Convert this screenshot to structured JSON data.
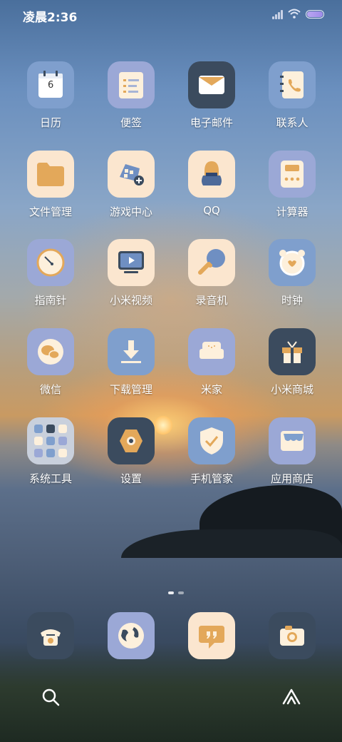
{
  "status": {
    "time": "凌晨2:36"
  },
  "apps": [
    {
      "label": "日历",
      "icon": "calendar-icon",
      "day": "6"
    },
    {
      "label": "便签",
      "icon": "notes-icon"
    },
    {
      "label": "电子邮件",
      "icon": "mail-icon"
    },
    {
      "label": "联系人",
      "icon": "contacts-icon"
    },
    {
      "label": "文件管理",
      "icon": "folder-icon"
    },
    {
      "label": "游戏中心",
      "icon": "gamepad-icon"
    },
    {
      "label": "QQ",
      "icon": "qq-icon"
    },
    {
      "label": "计算器",
      "icon": "calculator-icon"
    },
    {
      "label": "指南针",
      "icon": "compass-icon"
    },
    {
      "label": "小米视频",
      "icon": "video-icon"
    },
    {
      "label": "录音机",
      "icon": "recorder-icon"
    },
    {
      "label": "时钟",
      "icon": "clock-icon"
    },
    {
      "label": "微信",
      "icon": "wechat-icon"
    },
    {
      "label": "下载管理",
      "icon": "download-icon"
    },
    {
      "label": "米家",
      "icon": "mijia-icon"
    },
    {
      "label": "小米商城",
      "icon": "gift-icon"
    },
    {
      "label": "系统工具",
      "icon": "folder-grid-icon"
    },
    {
      "label": "设置",
      "icon": "settings-icon"
    },
    {
      "label": "手机管家",
      "icon": "security-shield-icon"
    },
    {
      "label": "应用商店",
      "icon": "store-icon"
    }
  ],
  "dock": [
    {
      "icon": "phone-icon"
    },
    {
      "icon": "browser-globe-icon"
    },
    {
      "icon": "messages-icon"
    },
    {
      "icon": "camera-icon"
    }
  ],
  "colors": {
    "tile_blue": "#7f9fcd",
    "tile_cream": "#fbe6cf",
    "tile_dark": "#3b4b5e",
    "accent_orange": "#e3a85a"
  }
}
